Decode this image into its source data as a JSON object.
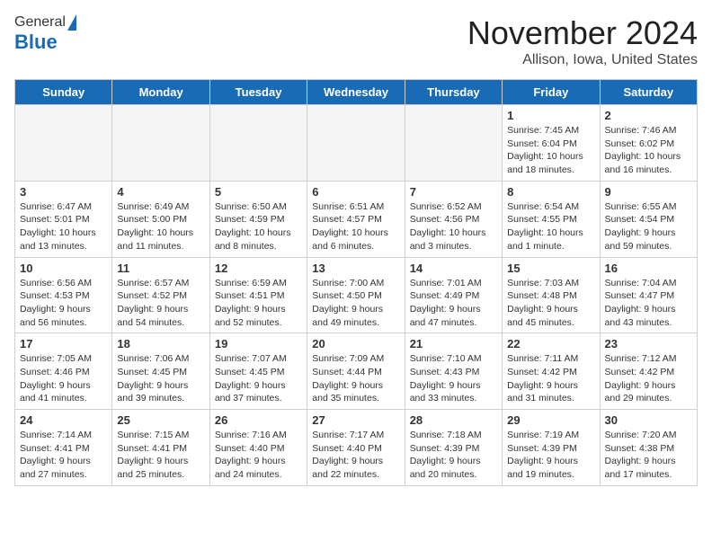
{
  "header": {
    "logo_general": "General",
    "logo_blue": "Blue",
    "month": "November 2024",
    "location": "Allison, Iowa, United States"
  },
  "days_of_week": [
    "Sunday",
    "Monday",
    "Tuesday",
    "Wednesday",
    "Thursday",
    "Friday",
    "Saturday"
  ],
  "weeks": [
    [
      {
        "day": "",
        "empty": true
      },
      {
        "day": "",
        "empty": true
      },
      {
        "day": "",
        "empty": true
      },
      {
        "day": "",
        "empty": true
      },
      {
        "day": "",
        "empty": true
      },
      {
        "day": "1",
        "sunrise": "Sunrise: 7:45 AM",
        "sunset": "Sunset: 6:04 PM",
        "daylight": "Daylight: 10 hours and 18 minutes."
      },
      {
        "day": "2",
        "sunrise": "Sunrise: 7:46 AM",
        "sunset": "Sunset: 6:02 PM",
        "daylight": "Daylight: 10 hours and 16 minutes."
      }
    ],
    [
      {
        "day": "3",
        "sunrise": "Sunrise: 6:47 AM",
        "sunset": "Sunset: 5:01 PM",
        "daylight": "Daylight: 10 hours and 13 minutes."
      },
      {
        "day": "4",
        "sunrise": "Sunrise: 6:49 AM",
        "sunset": "Sunset: 5:00 PM",
        "daylight": "Daylight: 10 hours and 11 minutes."
      },
      {
        "day": "5",
        "sunrise": "Sunrise: 6:50 AM",
        "sunset": "Sunset: 4:59 PM",
        "daylight": "Daylight: 10 hours and 8 minutes."
      },
      {
        "day": "6",
        "sunrise": "Sunrise: 6:51 AM",
        "sunset": "Sunset: 4:57 PM",
        "daylight": "Daylight: 10 hours and 6 minutes."
      },
      {
        "day": "7",
        "sunrise": "Sunrise: 6:52 AM",
        "sunset": "Sunset: 4:56 PM",
        "daylight": "Daylight: 10 hours and 3 minutes."
      },
      {
        "day": "8",
        "sunrise": "Sunrise: 6:54 AM",
        "sunset": "Sunset: 4:55 PM",
        "daylight": "Daylight: 10 hours and 1 minute."
      },
      {
        "day": "9",
        "sunrise": "Sunrise: 6:55 AM",
        "sunset": "Sunset: 4:54 PM",
        "daylight": "Daylight: 9 hours and 59 minutes."
      }
    ],
    [
      {
        "day": "10",
        "sunrise": "Sunrise: 6:56 AM",
        "sunset": "Sunset: 4:53 PM",
        "daylight": "Daylight: 9 hours and 56 minutes."
      },
      {
        "day": "11",
        "sunrise": "Sunrise: 6:57 AM",
        "sunset": "Sunset: 4:52 PM",
        "daylight": "Daylight: 9 hours and 54 minutes."
      },
      {
        "day": "12",
        "sunrise": "Sunrise: 6:59 AM",
        "sunset": "Sunset: 4:51 PM",
        "daylight": "Daylight: 9 hours and 52 minutes."
      },
      {
        "day": "13",
        "sunrise": "Sunrise: 7:00 AM",
        "sunset": "Sunset: 4:50 PM",
        "daylight": "Daylight: 9 hours and 49 minutes."
      },
      {
        "day": "14",
        "sunrise": "Sunrise: 7:01 AM",
        "sunset": "Sunset: 4:49 PM",
        "daylight": "Daylight: 9 hours and 47 minutes."
      },
      {
        "day": "15",
        "sunrise": "Sunrise: 7:03 AM",
        "sunset": "Sunset: 4:48 PM",
        "daylight": "Daylight: 9 hours and 45 minutes."
      },
      {
        "day": "16",
        "sunrise": "Sunrise: 7:04 AM",
        "sunset": "Sunset: 4:47 PM",
        "daylight": "Daylight: 9 hours and 43 minutes."
      }
    ],
    [
      {
        "day": "17",
        "sunrise": "Sunrise: 7:05 AM",
        "sunset": "Sunset: 4:46 PM",
        "daylight": "Daylight: 9 hours and 41 minutes."
      },
      {
        "day": "18",
        "sunrise": "Sunrise: 7:06 AM",
        "sunset": "Sunset: 4:45 PM",
        "daylight": "Daylight: 9 hours and 39 minutes."
      },
      {
        "day": "19",
        "sunrise": "Sunrise: 7:07 AM",
        "sunset": "Sunset: 4:45 PM",
        "daylight": "Daylight: 9 hours and 37 minutes."
      },
      {
        "day": "20",
        "sunrise": "Sunrise: 7:09 AM",
        "sunset": "Sunset: 4:44 PM",
        "daylight": "Daylight: 9 hours and 35 minutes."
      },
      {
        "day": "21",
        "sunrise": "Sunrise: 7:10 AM",
        "sunset": "Sunset: 4:43 PM",
        "daylight": "Daylight: 9 hours and 33 minutes."
      },
      {
        "day": "22",
        "sunrise": "Sunrise: 7:11 AM",
        "sunset": "Sunset: 4:42 PM",
        "daylight": "Daylight: 9 hours and 31 minutes."
      },
      {
        "day": "23",
        "sunrise": "Sunrise: 7:12 AM",
        "sunset": "Sunset: 4:42 PM",
        "daylight": "Daylight: 9 hours and 29 minutes."
      }
    ],
    [
      {
        "day": "24",
        "sunrise": "Sunrise: 7:14 AM",
        "sunset": "Sunset: 4:41 PM",
        "daylight": "Daylight: 9 hours and 27 minutes."
      },
      {
        "day": "25",
        "sunrise": "Sunrise: 7:15 AM",
        "sunset": "Sunset: 4:41 PM",
        "daylight": "Daylight: 9 hours and 25 minutes."
      },
      {
        "day": "26",
        "sunrise": "Sunrise: 7:16 AM",
        "sunset": "Sunset: 4:40 PM",
        "daylight": "Daylight: 9 hours and 24 minutes."
      },
      {
        "day": "27",
        "sunrise": "Sunrise: 7:17 AM",
        "sunset": "Sunset: 4:40 PM",
        "daylight": "Daylight: 9 hours and 22 minutes."
      },
      {
        "day": "28",
        "sunrise": "Sunrise: 7:18 AM",
        "sunset": "Sunset: 4:39 PM",
        "daylight": "Daylight: 9 hours and 20 minutes."
      },
      {
        "day": "29",
        "sunrise": "Sunrise: 7:19 AM",
        "sunset": "Sunset: 4:39 PM",
        "daylight": "Daylight: 9 hours and 19 minutes."
      },
      {
        "day": "30",
        "sunrise": "Sunrise: 7:20 AM",
        "sunset": "Sunset: 4:38 PM",
        "daylight": "Daylight: 9 hours and 17 minutes."
      }
    ]
  ]
}
